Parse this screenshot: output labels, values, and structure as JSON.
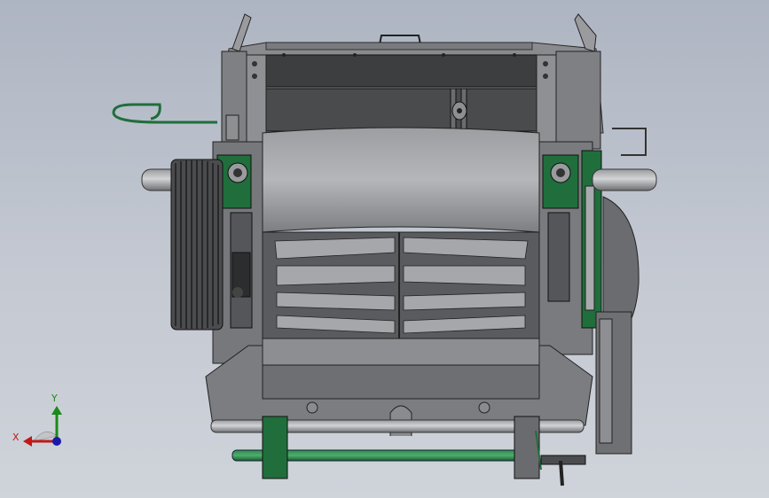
{
  "view": {
    "background_top": "#aeb5c2",
    "background_bottom": "#cfd3da",
    "model_metal_color": "#8c8d90",
    "model_dark_color": "#4a4b4d",
    "model_accent_color": "#1f6e3c"
  },
  "triad": {
    "x_label": "X",
    "y_label": "Y",
    "x_color": "#c01818",
    "y_color": "#1a8a1a",
    "z_color": "#1a1aa8"
  }
}
